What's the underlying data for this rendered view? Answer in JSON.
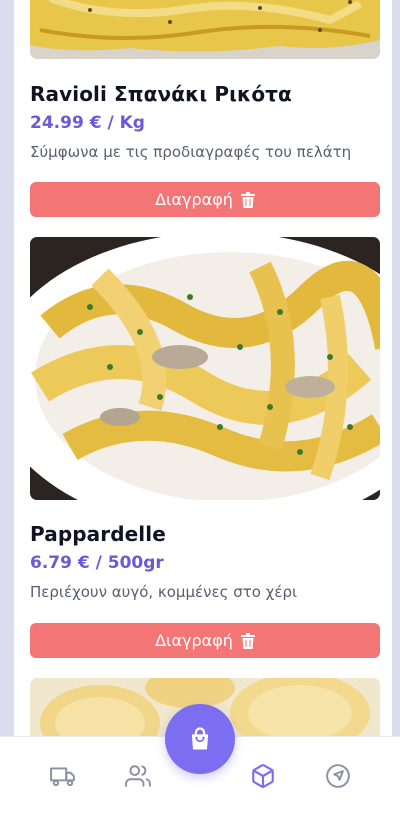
{
  "products": [
    {
      "name": "Ravioli Σπανάκι Ρικότα",
      "price": "24.99 € / Kg",
      "description": "Σύμφωνα με τις προδιαγραφές του πελάτη",
      "delete_label": "Διαγραφή"
    },
    {
      "name": "Pappardelle",
      "price": "6.79 € / 500gr",
      "description": "Περιέχουν αυγό, κομμένες στο χέρι",
      "delete_label": "Διαγραφή"
    }
  ],
  "icons": {
    "delete": "trash-icon",
    "fab": "shopping-bag-icon",
    "nav": [
      "truck-icon",
      "users-icon",
      "package-icon",
      "navigation-icon"
    ]
  },
  "colors": {
    "accent": "#7b6ef0",
    "price": "#6a5ad8",
    "delete": "#f37575",
    "nav_inactive": "#8a90a6"
  }
}
